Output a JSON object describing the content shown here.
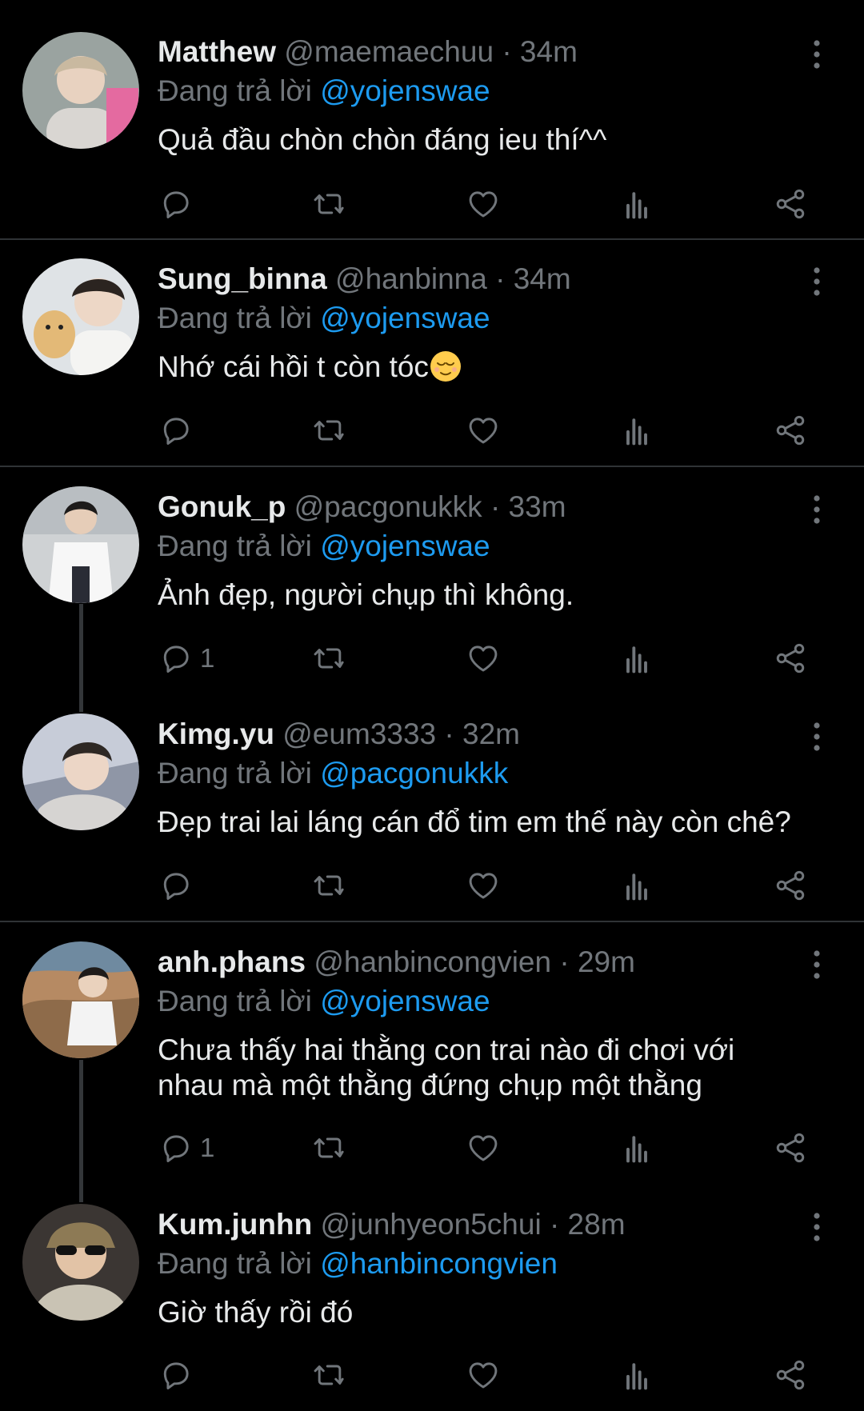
{
  "tweets": [
    {
      "name": "Matthew",
      "handle": "@maemaechuu",
      "time": "· 34m",
      "replying_prefix": "Đang trả lời ",
      "reply_to": "@yojenswae",
      "text": "Quả đầu chòn chòn đáng ieu thí^^",
      "reply_count": ""
    },
    {
      "name": "Sung_binna",
      "handle": "@hanbinna",
      "time": "· 34m",
      "replying_prefix": "Đang trả lời ",
      "reply_to": "@yojenswae",
      "text": "Nhớ cái hồi t còn tóc",
      "reply_count": ""
    },
    {
      "name": "Gonuk_p",
      "handle": "@pacgonukkk",
      "time": "· 33m",
      "replying_prefix": "Đang trả lời ",
      "reply_to": "@yojenswae",
      "text": "Ảnh đẹp, người chụp thì không.",
      "reply_count": "1"
    },
    {
      "name": "Kimg.yu",
      "handle": "@eum3333",
      "time": "· 32m",
      "replying_prefix": "Đang trả lời ",
      "reply_to": "@pacgonukkk",
      "text": "Đẹp trai lai láng cán đổ tim em thế này còn chê?",
      "reply_count": ""
    },
    {
      "name": "anh.phans",
      "handle": "@hanbincongvien",
      "time": "· 29m",
      "replying_prefix": "Đang trả lời ",
      "reply_to": "@yojenswae",
      "text": "Chưa thấy hai thằng con trai nào đi chơi với nhau mà một thằng đứng chụp một thằng",
      "reply_count": "1"
    },
    {
      "name": "Kum.junhn",
      "handle": "@junhyeon5chui",
      "time": "· 28m",
      "replying_prefix": "Đang trả lời ",
      "reply_to": "@hanbincongvien",
      "text": "Giờ thấy rồi đó",
      "reply_count": ""
    }
  ],
  "emoji": {
    "tweet_1": "relieved-face-emoji"
  },
  "colors": {
    "background": "#000000",
    "text": "#e7e9ea",
    "muted": "#71767b",
    "accent": "#1d9bf0",
    "divider": "#2f3336"
  },
  "icons": {
    "reply": "reply-icon",
    "retweet": "retweet-icon",
    "like": "heart-icon",
    "views": "views-icon",
    "share": "share-icon",
    "more": "more-vertical-icon"
  }
}
